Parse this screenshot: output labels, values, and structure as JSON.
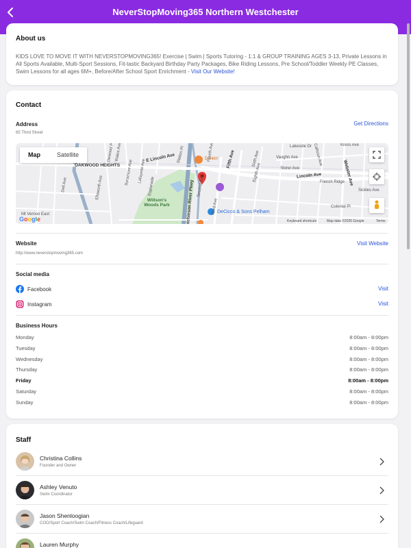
{
  "header": {
    "title": "NeverStopMoving365 Northern Westchester"
  },
  "about": {
    "title": "About us",
    "text": "KIDS LOVE TO MOVE IT WITH NEVERSTOPMOVING365! Exercise | Swim | Sports Tutoring - 1:1 & GROUP TRAINING AGES 3-13, Private Lessons in All Sports Available, Multi-Sport Sessions, Fit-tastic Backyard Birthday Party Packages, Bike Riding Lessons, Pre School/Toddler Weekly PE Classes, Swim Lessons for all ages 6M+, Before/After School Sport Enrichment - ",
    "link": "Visit Our Website!"
  },
  "contact": {
    "title": "Contact",
    "address_label": "Address",
    "address": "65 Third Street",
    "directions": "Get Directions",
    "map": {
      "tab_map": "Map",
      "tab_satellite": "Satellite",
      "labels": [
        "OAKWOOD HEIGHTS",
        "Willson's Woods Park",
        "E Lincoln Ave",
        "Lincoln Ave",
        "Fifth Ave",
        "Sixth Ave",
        "Eighth Ave",
        "Webster Ave",
        "Station Pl",
        "Dunkin'",
        "DeCicco & Sons Pelham",
        "Lakeside Dr",
        "Vaughn Ave",
        "Storer Ave",
        "French Ridge",
        "Sickles Ave",
        "Colonial Pl",
        "Kress Ave",
        "Calhoun Ave",
        "Fourth Ave",
        "Third Ave",
        "Second Ave",
        "Hutchinson River Pkwy",
        "Dell Ave",
        "Ellsworth Ave",
        "Lafayette Ave",
        "Sycamore Ave",
        "Esplanade",
        "Wales Ave",
        "Dewood Pl",
        "Mt Vernon East"
      ],
      "keyboard": "Keyboard shortcuts",
      "mapdata": "Map data ©2025 Google",
      "terms": "Terms",
      "google": "Google"
    },
    "website_label": "Website",
    "website_url": "http://www.neverstopmoving365.com",
    "visit_website": "Visit Website",
    "social_label": "Social media",
    "social": [
      {
        "name": "Facebook",
        "action": "Visit"
      },
      {
        "name": "Instagram",
        "action": "Visit"
      }
    ],
    "hours_label": "Business Hours",
    "hours": [
      {
        "day": "Monday",
        "time": "8:00am - 8:00pm"
      },
      {
        "day": "Tuesday",
        "time": "8:00am - 8:00pm"
      },
      {
        "day": "Wednesday",
        "time": "8:00am - 8:00pm"
      },
      {
        "day": "Thursday",
        "time": "8:00am - 8:00pm"
      },
      {
        "day": "Friday",
        "time": "8:00am - 8:00pm"
      },
      {
        "day": "Saturday",
        "time": "8:00am - 8:00pm"
      },
      {
        "day": "Sunday",
        "time": "8:00am - 8:00pm"
      }
    ]
  },
  "staff": {
    "title": "Staff",
    "members": [
      {
        "name": "Christina Collins",
        "role": "Founder and Owner"
      },
      {
        "name": "Ashley Venuto",
        "role": "Swim Coordinator"
      },
      {
        "name": "Jason Shenloogian",
        "role": "COO/Sport Coach/Swim Coach/Fitness Coach/Lifeguard"
      },
      {
        "name": "Lauren Murphy",
        "role": ""
      }
    ]
  },
  "colors": {
    "header": "#8a2be2",
    "link": "#2a53d6",
    "pin": "#e53935"
  }
}
